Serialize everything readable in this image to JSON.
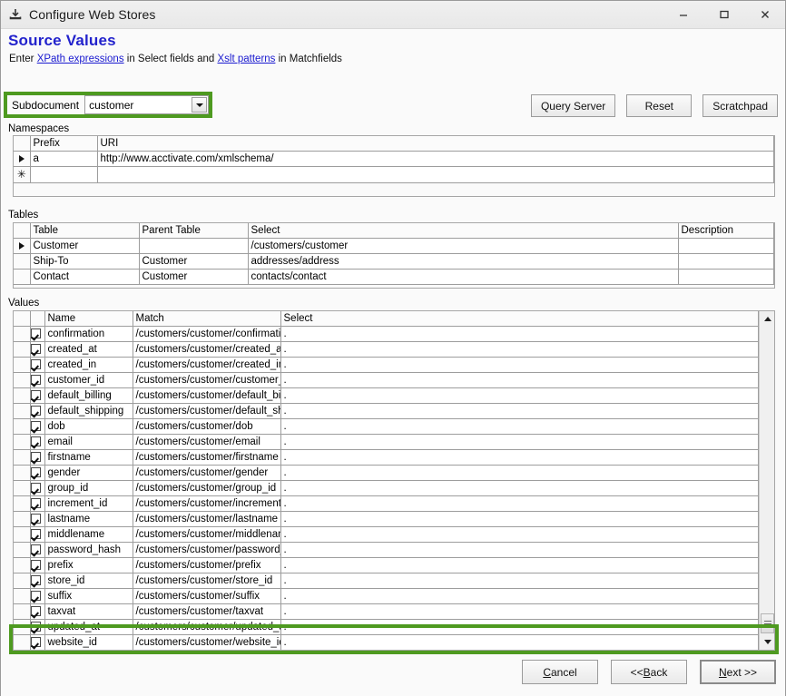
{
  "window": {
    "title": "Configure Web Stores",
    "icon": "save-download-icon",
    "controls": {
      "minimize": "minimize-icon",
      "maximize": "maximize-icon",
      "close": "close-icon"
    }
  },
  "page": {
    "heading": "Source Values",
    "subheading_parts": {
      "pre": "Enter ",
      "link1": "XPath expressions",
      "mid": " in Select fields and ",
      "link2": "Xslt patterns",
      "post": " in Matchfields"
    }
  },
  "subdocument": {
    "label": "Subdocument",
    "value": "customer",
    "arrow_icon": "chevron-down-icon"
  },
  "toolbar": {
    "query_server": "Query Server",
    "reset": "Reset",
    "scratchpad": "Scratchpad"
  },
  "namespaces": {
    "caption": "Namespaces",
    "columns": [
      "",
      "Prefix",
      "URI"
    ],
    "rows": [
      {
        "marker": "arrow",
        "prefix": "a",
        "uri": "http://www.acctivate.com/xmlschema/"
      },
      {
        "marker": "star",
        "prefix": "",
        "uri": ""
      }
    ]
  },
  "tables": {
    "caption": "Tables",
    "columns": [
      "",
      "Table",
      "Parent Table",
      "Select",
      "Description"
    ],
    "rows": [
      {
        "marker": "arrow",
        "table": "Customer",
        "parent": "",
        "select": "/customers/customer",
        "description": ""
      },
      {
        "marker": "",
        "table": "Ship-To",
        "parent": "Customer",
        "select": "addresses/address",
        "description": ""
      },
      {
        "marker": "",
        "table": "Contact",
        "parent": "Customer",
        "select": "contacts/contact",
        "description": ""
      }
    ]
  },
  "values": {
    "caption": "Values",
    "columns": [
      "",
      "",
      "Name",
      "Match",
      "Select"
    ],
    "rows": [
      {
        "checked": true,
        "name": "confirmation",
        "match": "/customers/customer/confirmation",
        "select": "."
      },
      {
        "checked": true,
        "name": "created_at",
        "match": "/customers/customer/created_at",
        "select": "."
      },
      {
        "checked": true,
        "name": "created_in",
        "match": "/customers/customer/created_in",
        "select": "."
      },
      {
        "checked": true,
        "name": "customer_id",
        "match": "/customers/customer/customer_id",
        "select": "."
      },
      {
        "checked": true,
        "name": "default_billing",
        "match": "/customers/customer/default_billing",
        "select": "."
      },
      {
        "checked": true,
        "name": "default_shipping",
        "match": "/customers/customer/default_shipping",
        "select": "."
      },
      {
        "checked": true,
        "name": "dob",
        "match": "/customers/customer/dob",
        "select": "."
      },
      {
        "checked": true,
        "name": "email",
        "match": "/customers/customer/email",
        "select": "."
      },
      {
        "checked": true,
        "name": "firstname",
        "match": "/customers/customer/firstname",
        "select": "."
      },
      {
        "checked": true,
        "name": "gender",
        "match": "/customers/customer/gender",
        "select": "."
      },
      {
        "checked": true,
        "name": "group_id",
        "match": "/customers/customer/group_id",
        "select": "."
      },
      {
        "checked": true,
        "name": "increment_id",
        "match": "/customers/customer/increment_id",
        "select": "."
      },
      {
        "checked": true,
        "name": "lastname",
        "match": "/customers/customer/lastname",
        "select": "."
      },
      {
        "checked": true,
        "name": "middlename",
        "match": "/customers/customer/middlename",
        "select": "."
      },
      {
        "checked": true,
        "name": "password_hash",
        "match": "/customers/customer/password_hash",
        "select": "."
      },
      {
        "checked": true,
        "name": "prefix",
        "match": "/customers/customer/prefix",
        "select": "."
      },
      {
        "checked": true,
        "name": "store_id",
        "match": "/customers/customer/store_id",
        "select": "."
      },
      {
        "checked": true,
        "name": "suffix",
        "match": "/customers/customer/suffix",
        "select": "."
      },
      {
        "checked": true,
        "name": "taxvat",
        "match": "/customers/customer/taxvat",
        "select": "."
      },
      {
        "checked": true,
        "name": "updated_at",
        "match": "/customers/customer/updated_at",
        "select": "."
      },
      {
        "checked": true,
        "name": "website_id",
        "match": "/customers/customer/website_id",
        "select": "."
      }
    ],
    "new_row": {
      "marker": "star",
      "checked": false,
      "name": "",
      "match": "",
      "select": ""
    },
    "scrollbar": {
      "up_icon": "scroll-up-icon",
      "down_icon": "scroll-down-icon"
    }
  },
  "footer": {
    "cancel": {
      "pre": "",
      "acc": "C",
      "post": "ancel"
    },
    "back": {
      "pre": "<< ",
      "acc": "B",
      "post": "ack"
    },
    "next": {
      "pre": "",
      "acc": "N",
      "post": "ext >>"
    }
  },
  "colors": {
    "highlight_green": "#4e9a20",
    "heading_blue": "#2222cc",
    "link_blue": "#1a1ad0"
  }
}
